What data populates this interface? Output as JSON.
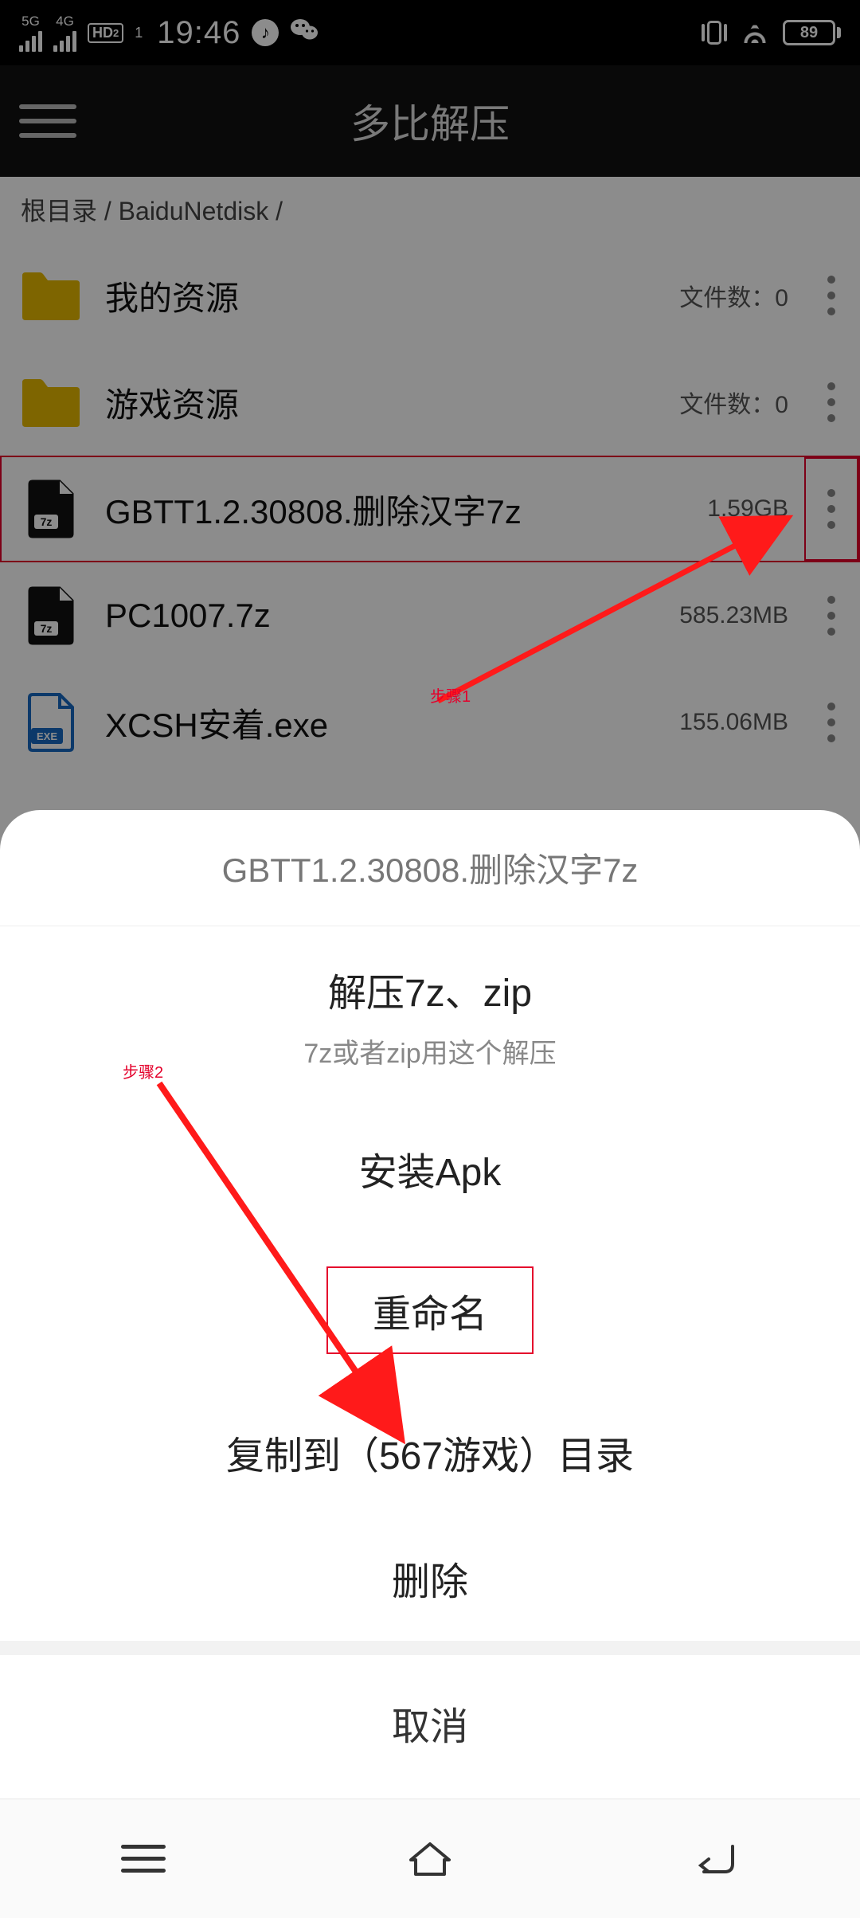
{
  "status": {
    "sig1": "5G",
    "sig2": "4G",
    "hd": "HD",
    "hd_sub": "2",
    "sim_slot": "1",
    "time": "19:46",
    "battery": "89"
  },
  "header": {
    "title": "多比解压"
  },
  "breadcrumb": "根目录 / BaiduNetdisk /",
  "files": [
    {
      "name": "我的资源",
      "meta": "文件数：0",
      "type": "folder"
    },
    {
      "name": "游戏资源",
      "meta": "文件数：0",
      "type": "folder"
    },
    {
      "name": "GBTT1.2.30808.删除汉字7z",
      "meta": "1.59GB",
      "type": "7z"
    },
    {
      "name": "PC1007.7z",
      "meta": "585.23MB",
      "type": "7z"
    },
    {
      "name": "XCSH安着.exe",
      "meta": "155.06MB",
      "type": "exe"
    }
  ],
  "annotations": {
    "step1": "步骤1",
    "step2": "步骤2"
  },
  "sheet": {
    "title": "GBTT1.2.30808.删除汉字7z",
    "items": [
      {
        "label": "解压7z、zip",
        "sub": "7z或者zip用这个解压"
      },
      {
        "label": "安装Apk"
      },
      {
        "label": "重命名"
      },
      {
        "label": "复制到（567游戏）目录"
      },
      {
        "label": "删除"
      }
    ],
    "cancel": "取消"
  }
}
